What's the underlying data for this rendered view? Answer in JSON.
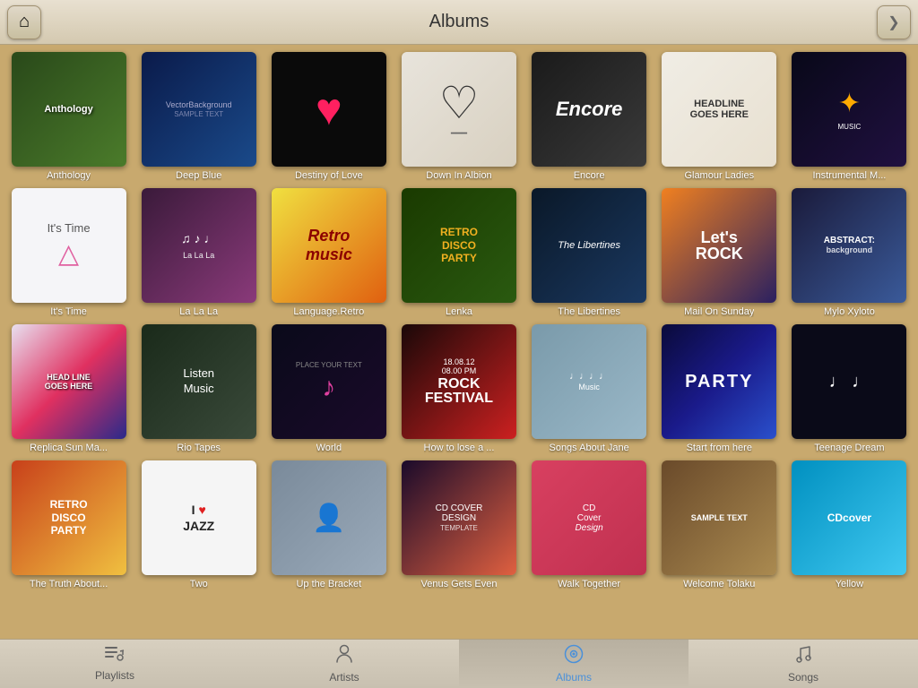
{
  "header": {
    "title": "Albums",
    "back_icon": "⌂",
    "more_icon": "❯"
  },
  "albums": [
    {
      "id": "anthology",
      "title": "Anthology",
      "cover_class": "cover-anthology",
      "cover_text": "Anthology",
      "cover_sub": ""
    },
    {
      "id": "deepblue",
      "title": "Deep Blue",
      "cover_class": "cover-deepblue",
      "cover_text": "VectorBackground",
      "cover_sub": "SMPLE TEXT"
    },
    {
      "id": "destiny",
      "title": "Destiny of Love",
      "cover_class": "cover-destiny",
      "cover_text": "♥",
      "cover_sub": ""
    },
    {
      "id": "downalbion",
      "title": "Down In Albion",
      "cover_class": "cover-downalbion",
      "cover_text": "♡",
      "cover_sub": ""
    },
    {
      "id": "encore",
      "title": "Encore",
      "cover_class": "cover-encore",
      "cover_text": "Encore",
      "cover_sub": ""
    },
    {
      "id": "glamour",
      "title": "Glamour Ladies",
      "cover_class": "cover-glamour",
      "cover_text": "HEADLINE GOES HERE",
      "cover_sub": ""
    },
    {
      "id": "instrumental",
      "title": "Instrumental M...",
      "cover_class": "cover-instrumental",
      "cover_text": "✦",
      "cover_sub": ""
    },
    {
      "id": "itstime",
      "title": "It's Time",
      "cover_class": "cover-itstime",
      "cover_text": "It's Time",
      "cover_sub": ""
    },
    {
      "id": "lalala",
      "title": "La La La",
      "cover_class": "cover-lalala",
      "cover_text": "♫",
      "cover_sub": ""
    },
    {
      "id": "language",
      "title": "Language.Retro",
      "cover_class": "cover-language",
      "cover_text": "Retro music",
      "cover_sub": ""
    },
    {
      "id": "lenka",
      "title": "Lenka",
      "cover_class": "cover-lenka",
      "cover_text": "RETRO DISCO PARTY",
      "cover_sub": ""
    },
    {
      "id": "libertines",
      "title": "The Libertines",
      "cover_class": "cover-libertines",
      "cover_text": "The Libertines",
      "cover_sub": ""
    },
    {
      "id": "mailsunday",
      "title": "Mail On Sunday",
      "cover_class": "cover-mailsunday",
      "cover_text": "Let's ROCK",
      "cover_sub": ""
    },
    {
      "id": "mylo",
      "title": "Mylo Xyloto",
      "cover_class": "cover-mylo",
      "cover_text": "ABSTRACT:",
      "cover_sub": "background"
    },
    {
      "id": "replica",
      "title": "Replica Sun Ma...",
      "cover_class": "cover-replica",
      "cover_text": "HEAD LINE GOES HERE",
      "cover_sub": ""
    },
    {
      "id": "rio",
      "title": "Rio Tapes",
      "cover_class": "cover-rio",
      "cover_text": "Listen Music",
      "cover_sub": ""
    },
    {
      "id": "world",
      "title": "World",
      "cover_class": "cover-world",
      "cover_text": "PLACE YOUR TEXT",
      "cover_sub": "♪"
    },
    {
      "id": "howtol",
      "title": "How to lose a ...",
      "cover_class": "cover-howtol",
      "cover_text": "ROCK FESTIVAL",
      "cover_sub": "18.08.12"
    },
    {
      "id": "songs",
      "title": "Songs About Jane",
      "cover_class": "cover-songs",
      "cover_text": "Music",
      "cover_sub": "♪"
    },
    {
      "id": "start",
      "title": "Start from here",
      "cover_class": "cover-start",
      "cover_text": "PARTY",
      "cover_sub": ""
    },
    {
      "id": "teenage",
      "title": "Teenage Dream",
      "cover_class": "cover-teenage",
      "cover_text": "♩♩",
      "cover_sub": ""
    },
    {
      "id": "truth",
      "title": "The Truth About...",
      "cover_class": "cover-truth",
      "cover_text": "RETRO DISCO PARTY",
      "cover_sub": ""
    },
    {
      "id": "two",
      "title": "Two",
      "cover_class": "cover-two",
      "cover_text": "I ♥ JAZZ",
      "cover_sub": ""
    },
    {
      "id": "upbracket",
      "title": "Up the Bracket",
      "cover_class": "cover-upbracket",
      "cover_text": "",
      "cover_sub": ""
    },
    {
      "id": "venus",
      "title": "Venus Gets Even",
      "cover_class": "cover-venus",
      "cover_text": "CD COVER",
      "cover_sub": "TEMPLATE"
    },
    {
      "id": "walk",
      "title": "Walk Together",
      "cover_class": "cover-walk",
      "cover_text": "CD Cover Design",
      "cover_sub": ""
    },
    {
      "id": "welcome",
      "title": "Welcome Tolaku",
      "cover_class": "cover-welcome",
      "cover_text": "SAMPLE TEXT",
      "cover_sub": ""
    },
    {
      "id": "yellow",
      "title": "Yellow",
      "cover_class": "cover-yellow",
      "cover_text": "CDcover",
      "cover_sub": ""
    }
  ],
  "nav": {
    "items": [
      {
        "id": "playlists",
        "label": "Playlists",
        "icon": "≡",
        "active": false
      },
      {
        "id": "artists",
        "label": "Artists",
        "icon": "♟",
        "active": false
      },
      {
        "id": "albums",
        "label": "Albums",
        "icon": "◉",
        "active": true
      },
      {
        "id": "songs",
        "label": "Songs",
        "icon": "♪",
        "active": false
      }
    ]
  }
}
